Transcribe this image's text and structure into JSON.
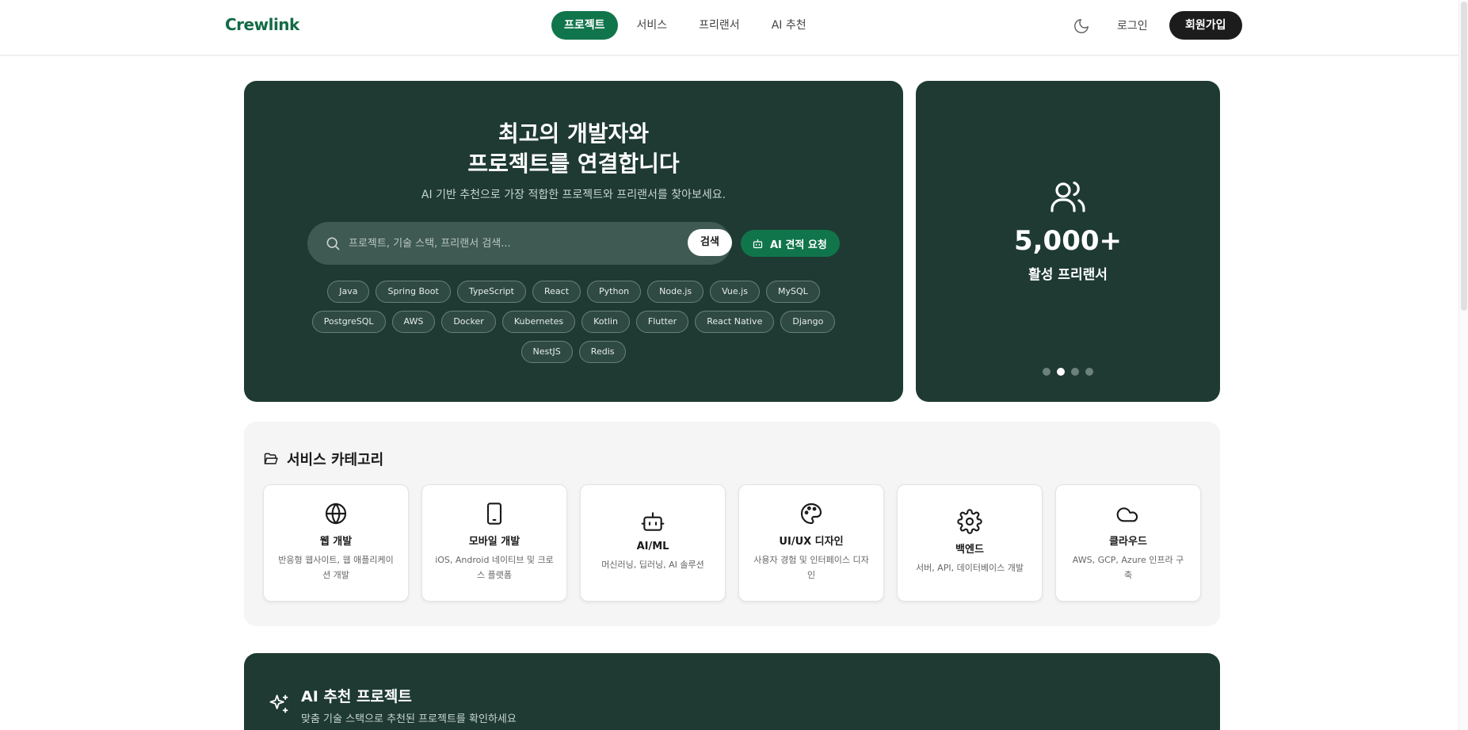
{
  "header": {
    "logo": "Crewlink",
    "nav": [
      {
        "label": "프로젝트",
        "active": true
      },
      {
        "label": "서비스",
        "active": false
      },
      {
        "label": "프리랜서",
        "active": false
      },
      {
        "label": "AI 추천",
        "active": false
      }
    ],
    "theme_icon": "moon-icon",
    "login_label": "로그인",
    "signup_label": "회원가입"
  },
  "hero": {
    "title_line1": "최고의 개발자와",
    "title_line2": "프로젝트를 연결합니다",
    "subtitle": "AI 기반 추천으로 가장 적합한 프로젝트와 프리랜서를 찾아보세요.",
    "search_placeholder": "프로젝트, 기술 스택, 프리랜서 검색...",
    "search_button": "검색",
    "ai_quote_button": "AI 견적 요청",
    "chips": [
      "Java",
      "Spring Boot",
      "TypeScript",
      "React",
      "Python",
      "Node.js",
      "Vue.js",
      "MySQL",
      "PostgreSQL",
      "AWS",
      "Docker",
      "Kubernetes",
      "Kotlin",
      "Flutter",
      "React Native",
      "Django",
      "NestJS",
      "Redis"
    ]
  },
  "stat_card": {
    "icon": "users-icon",
    "number": "5,000+",
    "label": "활성 프리랜서",
    "slide_count": 4,
    "active_slide": 2
  },
  "categories": {
    "title": "서비스 카테고리",
    "items": [
      {
        "name": "웹 개발",
        "desc": "반응형 웹사이트, 웹 애플리케이션 개발",
        "icon": "globe-icon"
      },
      {
        "name": "모바일 개발",
        "desc": "iOS, Android 네이티브 및 크로스 플랫폼",
        "icon": "smartphone-icon"
      },
      {
        "name": "AI/ML",
        "desc": "머신러닝, 딥러닝, AI 솔루션",
        "icon": "bot-icon"
      },
      {
        "name": "UI/UX 디자인",
        "desc": "사용자 경험 및 인터페이스 디자인",
        "icon": "palette-icon"
      },
      {
        "name": "백엔드",
        "desc": "서버, API, 데이터베이스 개발",
        "icon": "gear-icon"
      },
      {
        "name": "클라우드",
        "desc": "AWS, GCP, Azure 인프라 구축",
        "icon": "cloud-icon"
      }
    ]
  },
  "ai_section": {
    "title": "AI 추천 프로젝트",
    "subtitle": "맞춤 기술 스택으로 추천된 프로젝트를 확인하세요"
  },
  "colors": {
    "brand": "#10754b",
    "panel": "#1e3a32",
    "dark_button": "#1c1c1c"
  }
}
